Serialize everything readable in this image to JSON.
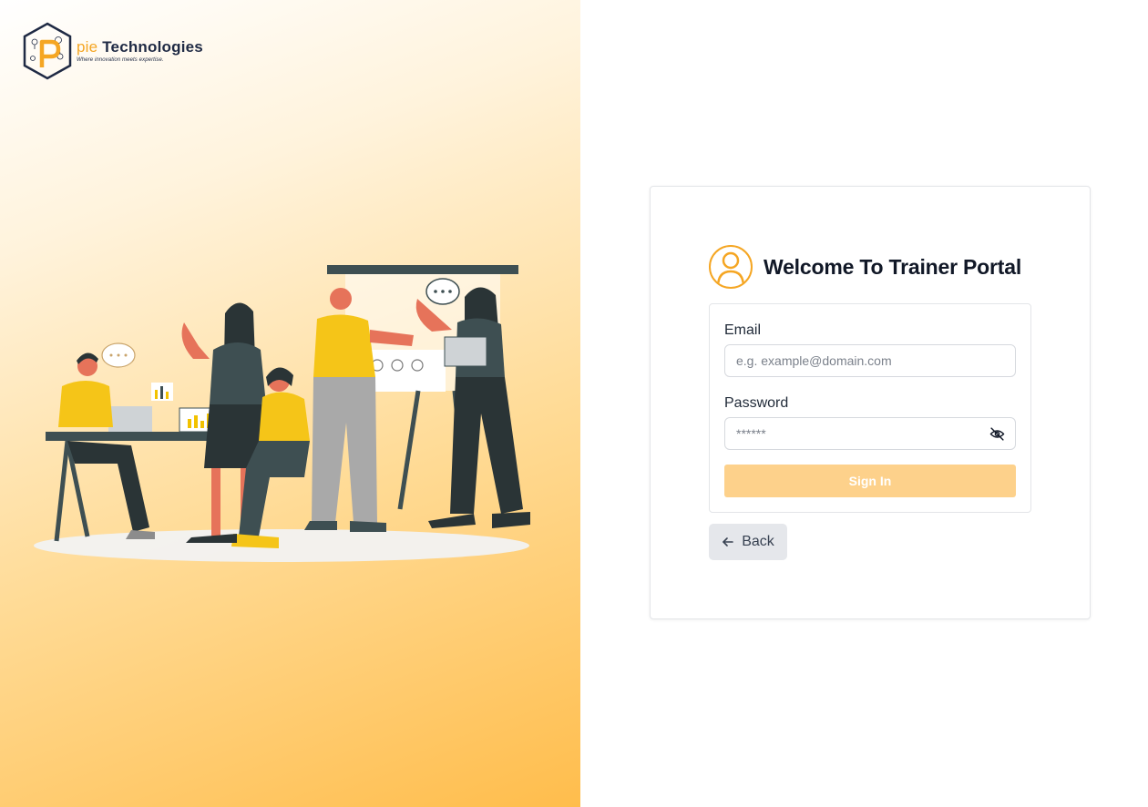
{
  "brand": {
    "name_prefix": "pie",
    "name_suffix": " Technologies",
    "tagline": "Where innovation meets expertise."
  },
  "illustration": {
    "icon": "team-meeting-illustration"
  },
  "login": {
    "title": "Welcome To Trainer Portal",
    "avatar_icon": "user-avatar-icon",
    "email_label": "Email",
    "email_placeholder": "e.g. example@domain.com",
    "email_value": "",
    "password_label": "Password",
    "password_placeholder": "******",
    "password_value": "",
    "password_toggle_icon": "eye-off-icon",
    "signin_label": "Sign In",
    "back_label": "Back",
    "back_icon": "arrow-left-icon"
  },
  "colors": {
    "accent": "#f5a623",
    "signin_button": "#fdd18b",
    "title_text": "#111827",
    "back_button_bg": "#e5e7eb"
  }
}
